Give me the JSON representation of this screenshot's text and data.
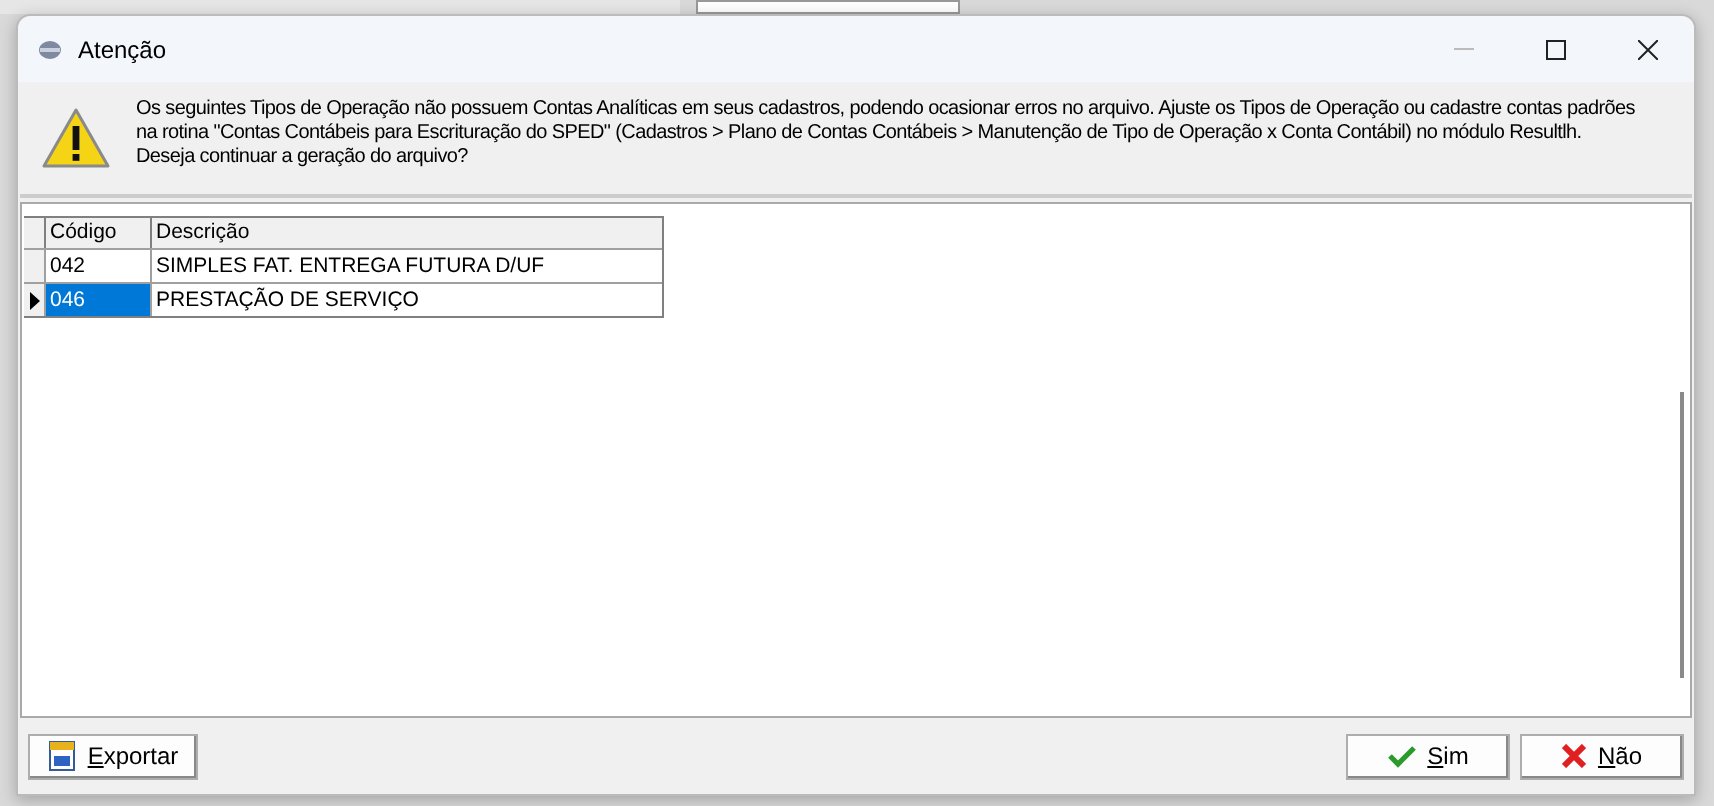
{
  "window": {
    "title": "Atenção"
  },
  "message": {
    "lines": [
      "Os seguintes Tipos de Operação não possuem Contas Analíticas em seus cadastros, podendo ocasionar erros no arquivo. Ajuste os Tipos de Operação ou cadastre contas padrões",
      "na rotina \"Contas Contábeis para Escrituração do SPED\" (Cadastros > Plano de Contas Contábeis > Manutenção de Tipo de Operação x Conta Contábil) no módulo Resultlh.",
      "Deseja continuar a geração do arquivo?"
    ]
  },
  "table": {
    "columns": [
      "Código",
      "Descrição"
    ],
    "rows": [
      {
        "cells": [
          "042",
          "SIMPLES FAT. ENTREGA FUTURA D/UF"
        ],
        "selected": false
      },
      {
        "cells": [
          "046",
          "PRESTAÇÃO DE SERVIÇO"
        ],
        "selected": true
      }
    ]
  },
  "buttons": [
    {
      "kind": "export",
      "label": "Exportar"
    },
    {
      "kind": "yes",
      "label": "Sim"
    },
    {
      "kind": "no",
      "label": "Não"
    }
  ]
}
